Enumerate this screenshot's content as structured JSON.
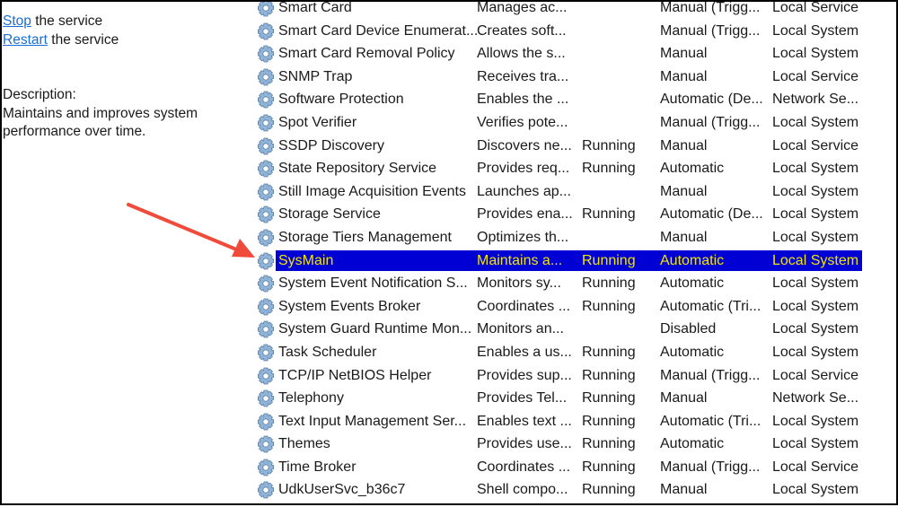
{
  "actions": {
    "stop_link": "Stop",
    "stop_suffix": " the service",
    "restart_link": "Restart",
    "restart_suffix": " the service"
  },
  "description": {
    "label": "Description:",
    "text": "Maintains and improves system performance over time."
  },
  "colors": {
    "selection_bg": "#0000d4",
    "selection_text": "#f2e600",
    "arrow": "#f04a3a",
    "link": "#1a6fd6"
  },
  "services": [
    {
      "name": "Smart Card",
      "description": "Manages ac...",
      "status": "",
      "startup": "Manual (Trigg...",
      "logon": "Local Service"
    },
    {
      "name": "Smart Card Device Enumerat...",
      "description": "Creates soft...",
      "status": "",
      "startup": "Manual (Trigg...",
      "logon": "Local System"
    },
    {
      "name": "Smart Card Removal Policy",
      "description": "Allows the s...",
      "status": "",
      "startup": "Manual",
      "logon": "Local System"
    },
    {
      "name": "SNMP Trap",
      "description": "Receives tra...",
      "status": "",
      "startup": "Manual",
      "logon": "Local Service"
    },
    {
      "name": "Software Protection",
      "description": "Enables the ...",
      "status": "",
      "startup": "Automatic (De...",
      "logon": "Network Se..."
    },
    {
      "name": "Spot Verifier",
      "description": "Verifies pote...",
      "status": "",
      "startup": "Manual (Trigg...",
      "logon": "Local System"
    },
    {
      "name": "SSDP Discovery",
      "description": "Discovers ne...",
      "status": "Running",
      "startup": "Manual",
      "logon": "Local Service"
    },
    {
      "name": "State Repository Service",
      "description": "Provides req...",
      "status": "Running",
      "startup": "Automatic",
      "logon": "Local System"
    },
    {
      "name": "Still Image Acquisition Events",
      "description": "Launches ap...",
      "status": "",
      "startup": "Manual",
      "logon": "Local System"
    },
    {
      "name": "Storage Service",
      "description": "Provides ena...",
      "status": "Running",
      "startup": "Automatic (De...",
      "logon": "Local System"
    },
    {
      "name": "Storage Tiers Management",
      "description": "Optimizes th...",
      "status": "",
      "startup": "Manual",
      "logon": "Local System"
    },
    {
      "name": "SysMain",
      "description": "Maintains a...",
      "status": "Running",
      "startup": "Automatic",
      "logon": "Local System",
      "selected": true
    },
    {
      "name": "System Event Notification S...",
      "description": "Monitors sy...",
      "status": "Running",
      "startup": "Automatic",
      "logon": "Local System"
    },
    {
      "name": "System Events Broker",
      "description": "Coordinates ...",
      "status": "Running",
      "startup": "Automatic (Tri...",
      "logon": "Local System"
    },
    {
      "name": "System Guard Runtime Mon...",
      "description": "Monitors an...",
      "status": "",
      "startup": "Disabled",
      "logon": "Local System"
    },
    {
      "name": "Task Scheduler",
      "description": "Enables a us...",
      "status": "Running",
      "startup": "Automatic",
      "logon": "Local System"
    },
    {
      "name": "TCP/IP NetBIOS Helper",
      "description": "Provides sup...",
      "status": "Running",
      "startup": "Manual (Trigg...",
      "logon": "Local Service"
    },
    {
      "name": "Telephony",
      "description": "Provides Tel...",
      "status": "Running",
      "startup": "Manual",
      "logon": "Network Se..."
    },
    {
      "name": "Text Input Management Ser...",
      "description": "Enables text ...",
      "status": "Running",
      "startup": "Automatic (Tri...",
      "logon": "Local System"
    },
    {
      "name": "Themes",
      "description": "Provides use...",
      "status": "Running",
      "startup": "Automatic",
      "logon": "Local System"
    },
    {
      "name": "Time Broker",
      "description": "Coordinates ...",
      "status": "Running",
      "startup": "Manual (Trigg...",
      "logon": "Local Service"
    },
    {
      "name": "UdkUserSvc_b36c7",
      "description": "Shell compo...",
      "status": "Running",
      "startup": "Manual",
      "logon": "Local System"
    }
  ]
}
